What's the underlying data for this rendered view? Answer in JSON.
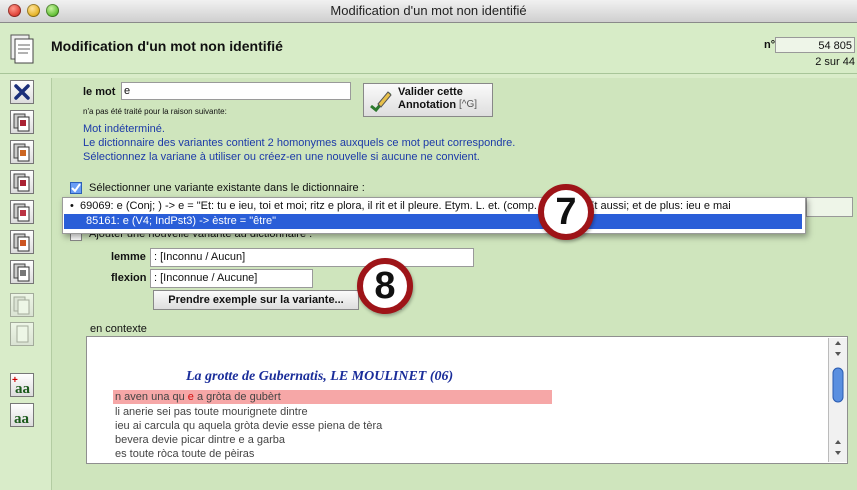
{
  "window": {
    "title": "Modification d'un mot non identifié"
  },
  "header": {
    "title": "Modification d'un mot non identifié",
    "num_label": "n°",
    "num_value": "54 805",
    "pager": "2 sur 44"
  },
  "form": {
    "mot_label": "le mot",
    "mot_value": "e",
    "reason_intro": "n'a pas été traité pour la raison suivante:",
    "reason_lines": [
      "Mot indéterminé.",
      "Le dictionnaire des variantes contient 2 homonymes auxquels ce mot peut correspondre.",
      "Sélectionnez la variane à utiliser ou créez-en une nouvelle si aucune ne convient."
    ],
    "valider_label_line1": "Valider cette",
    "valider_label_line2": "Annotation",
    "valider_shortcut": "[^G]",
    "option_select_label": "Sélectionner une variante existante dans le dictionnaire :",
    "option_add_label": "Ajouter une nouvelle variante au dictionnaire :",
    "dropdown_options": [
      "69069: e (Conj; ) -> e = \"Et: tu e ieu, toi et moi; ritz e plora, il rit et il pleure. Etym. L. et. (comp. mai conj. Et aussi; et de plus: ieu e mai",
      "85161: e (V4; IndPst3) -> èstre = \"être\""
    ],
    "lemme_label": "lemme",
    "lemme_value": ": [Inconnu / Aucun]",
    "flexion_label": "flexion",
    "flexion_value": ": [Inconnue / Aucune]",
    "prendre_label": "Prendre exemple sur la variante..."
  },
  "context": {
    "label": "en contexte",
    "title": "La grotte de Gubernatis, LE MOULINET (06)",
    "lines": [
      "n aven una qu e a gròta de gubèrt",
      "li anerie sei pas toute mourignete dintre",
      "ieu ai carcula qu aquela gròta devie esse piena de tèra",
      "bevera devie picar dintre e a garba",
      "es toute ròca toute de pèiras"
    ]
  },
  "annotations": {
    "seven": "7",
    "eight": "8"
  },
  "toolbar_icons": [
    "delete-x-icon",
    "document-icon",
    "document-icon",
    "document-icon",
    "document-icon",
    "document-icon",
    "document-icon",
    "document-icon",
    "document-icon",
    "add-annotation-icon",
    "annotation-icon"
  ]
}
